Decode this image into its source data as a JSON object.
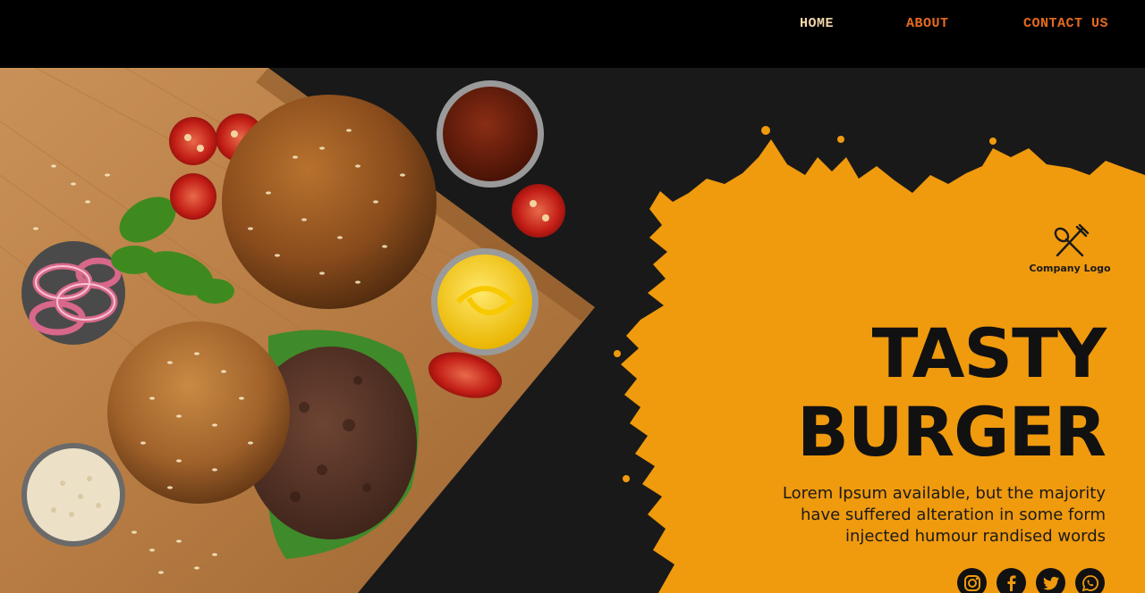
{
  "nav": {
    "items": [
      {
        "label": "HOME",
        "color": "#f3d6a8"
      },
      {
        "label": "ABOUT",
        "color": "#e66a1f"
      },
      {
        "label": "CONTACT US",
        "color": "#e66a1f"
      }
    ]
  },
  "hero": {
    "logo_text": "Company Logo",
    "title_line1": "TASTY",
    "title_line2": "BURGER",
    "description_line1": "Lorem Ipsum available, but the majority",
    "description_line2": "have suffered alteration in some form",
    "description_line3": "injected humour randised words",
    "accent_color": "#f09a0e",
    "background_color": "#191919"
  },
  "socials": [
    {
      "name": "instagram-icon"
    },
    {
      "name": "facebook-icon"
    },
    {
      "name": "twitter-icon"
    },
    {
      "name": "whatsapp-icon"
    }
  ]
}
